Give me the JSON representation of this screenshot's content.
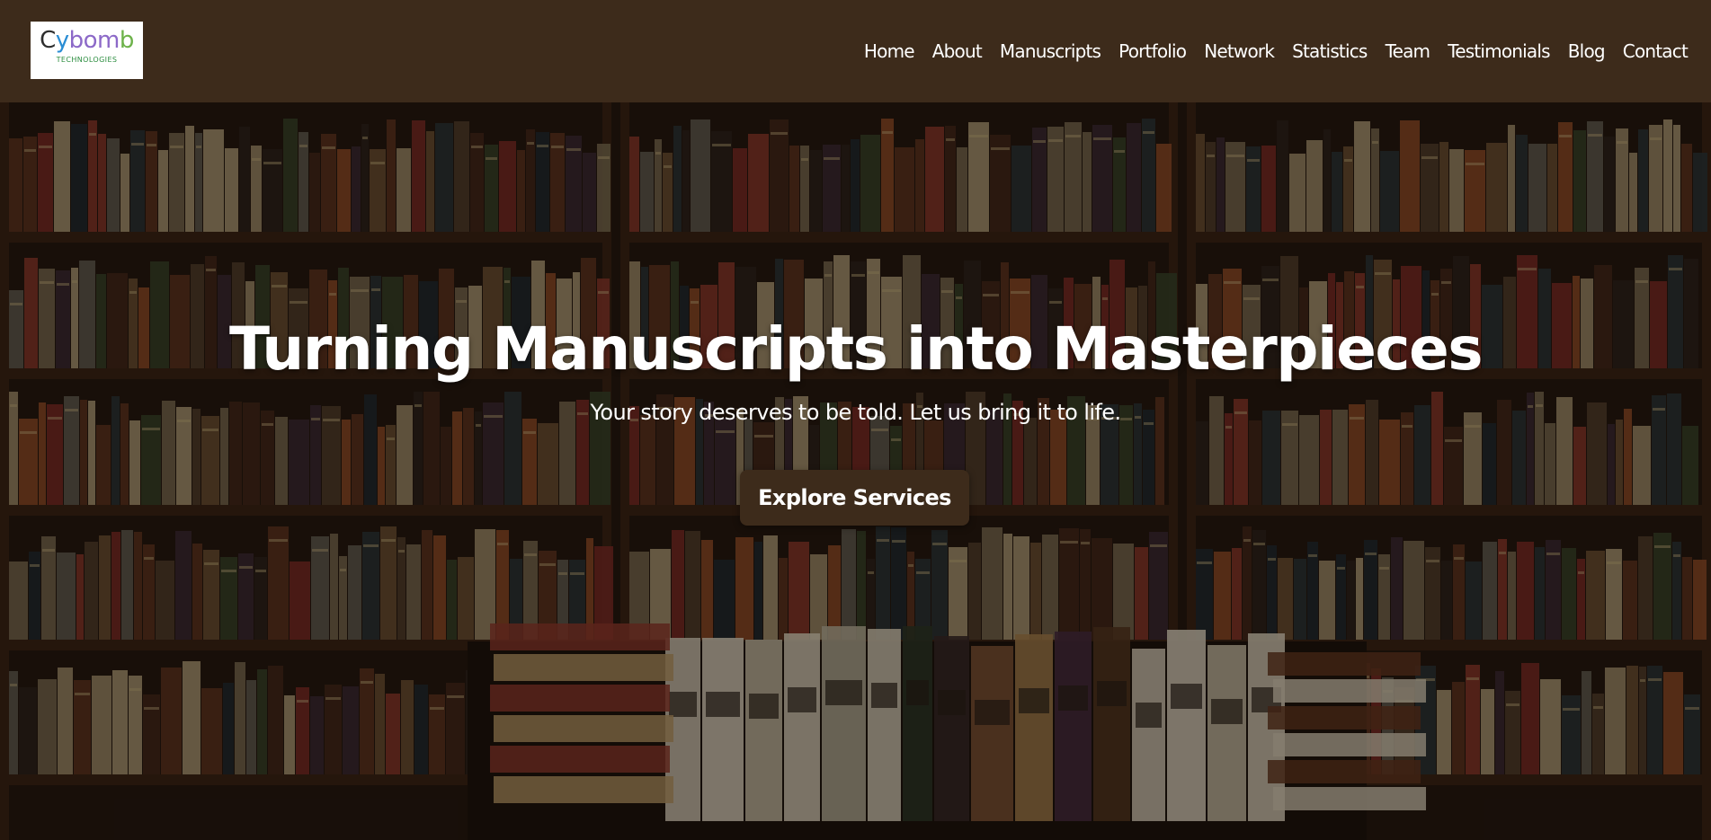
{
  "brand": {
    "logo_parts": [
      "C",
      "y",
      "bom",
      "b"
    ],
    "logo_tagline": "TECHNOLOGIES",
    "colors": {
      "header_bg": "#3d2b1b",
      "logo_dark": "#2e2e2e",
      "logo_blue": "#2a8dd4",
      "logo_purple": "#8c69c8",
      "logo_green": "#6db24a",
      "cta_bg": "#3d2b1b"
    }
  },
  "nav": {
    "items": [
      "Home",
      "About",
      "Manuscripts",
      "Portfolio",
      "Network",
      "Statistics",
      "Team",
      "Testimonials",
      "Blog",
      "Contact"
    ]
  },
  "hero": {
    "title": "Turning Manuscripts into Masterpieces",
    "subtitle": "Your story deserves to be told. Let us bring it to life.",
    "cta_label": "Explore Services",
    "background": "bookshelf-photo"
  }
}
